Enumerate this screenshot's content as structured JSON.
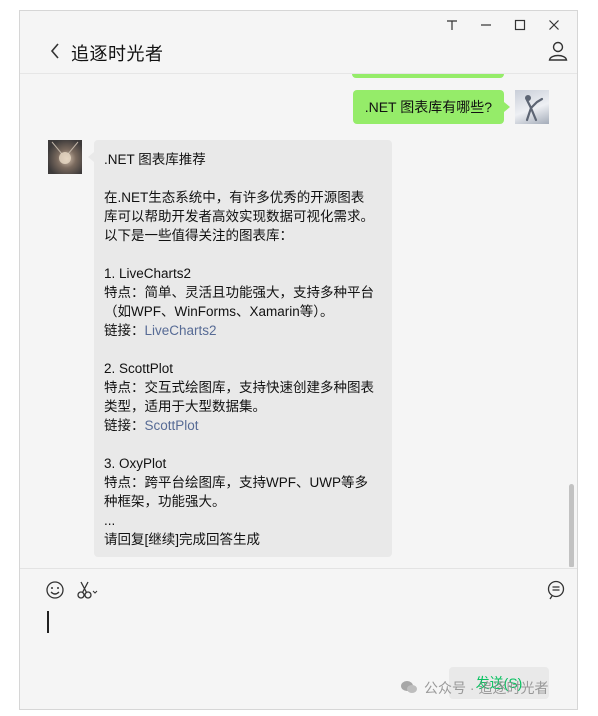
{
  "window": {
    "title": "追逐时光者",
    "controls": [
      "pin-icon",
      "minimize-icon",
      "maximize-icon",
      "close-icon"
    ]
  },
  "chat": {
    "user_message": ".NET 图表库有哪些?",
    "bot_message_lines": [
      ".NET 图表库推荐",
      "",
      "在.NET生态系统中，有许多优秀的开源图表",
      "库可以帮助开发者高效实现数据可视化需求。",
      "以下是一些值得关注的图表库：",
      "",
      "1. LiveCharts2",
      "特点：简单、灵活且功能强大，支持多种平台",
      "（如WPF、WinForms、Xamarin等）。",
      "",
      "2. ScottPlot",
      "特点：交互式绘图库，支持快速创建多种图表",
      "类型，适用于大型数据集。",
      "",
      "3. OxyPlot",
      "特点：跨平台绘图库，支持WPF、UWP等多",
      "种框架，功能强大。",
      "...",
      "请回复[继续]完成回答生成"
    ],
    "link_prefix": "链接：",
    "links": [
      "LiveCharts2",
      "ScottPlot"
    ]
  },
  "input": {
    "send_label": "发送(S)"
  },
  "watermark": {
    "text": "公众号 · 追逐时光者"
  },
  "colors": {
    "user_bubble": "#95ec69",
    "bot_bubble": "#e9e9e9",
    "link": "#576b95",
    "send_text": "#07c160"
  }
}
